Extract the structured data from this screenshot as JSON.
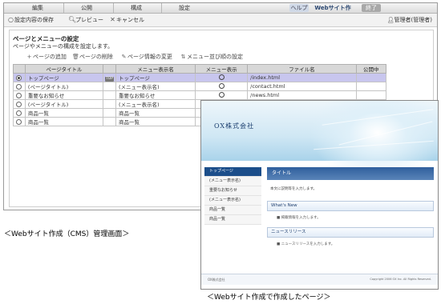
{
  "cms": {
    "tabs": [
      "編集",
      "公開",
      "構成",
      "設定"
    ],
    "help": "ヘルプ",
    "app_name": "Webサイト作成",
    "end": "終了",
    "toolbar": {
      "save": "設定内容の保存",
      "preview": "プレビュー",
      "cancel": "キャンセル"
    },
    "user": "管理者(管理者)",
    "section_title": "ページとメニューの設定",
    "section_desc": "ページやメニューの構成を設定します。",
    "actions": {
      "add": "ページの追加",
      "delete": "ページの削除",
      "edit": "ページ情報の変更",
      "sort": "メニュー並び順の設定"
    },
    "columns": [
      "ページタイトル",
      "メニュー表示名",
      "メニュー表示",
      "ファイル名",
      "公開中"
    ],
    "top_badge": "TOP",
    "rows": [
      {
        "title": "トップページ",
        "menu": "トップページ",
        "file": "/index.html",
        "shown": true,
        "top": true,
        "selected": true
      },
      {
        "title": "(ページタイトル)",
        "menu": "(メニュー表示名)",
        "file": "/contact.html",
        "shown": true,
        "top": false,
        "selected": false
      },
      {
        "title": "重要なお知らせ",
        "menu": "重要なお知らせ",
        "file": "/news.html",
        "shown": true,
        "top": false,
        "selected": false
      },
      {
        "title": "(ページタイトル)",
        "menu": "(メニュー表示名)",
        "file": "",
        "shown": false,
        "top": false,
        "selected": false
      },
      {
        "title": "商品一覧",
        "menu": "商品一覧",
        "file": "",
        "shown": false,
        "top": false,
        "selected": false
      },
      {
        "title": "商品一覧",
        "menu": "商品一覧",
        "file": "",
        "shown": false,
        "top": false,
        "selected": false
      }
    ]
  },
  "web": {
    "company": "OX株式会社",
    "nav": [
      "トップページ",
      "(メニュー表示名)",
      "重要なお知らせ",
      "(メニュー表示名)",
      "商品一覧",
      "商品一覧"
    ],
    "title": "タイトル",
    "body_text": "本文に説明等を入力します。",
    "whats_new": "What's New",
    "whats_new_item": "掲載情報を入力します。",
    "news_release": "ニュースリリース",
    "news_item": "ニュースリリースを入力します。",
    "footer_left": "OX株式会社",
    "footer_right": "Copyright 2006 OX Inc. All Rights Reserved."
  },
  "captions": {
    "cms": "＜Webサイト作成（CMS）管理画面＞",
    "web": "＜Webサイト作成で作成したページ＞"
  }
}
